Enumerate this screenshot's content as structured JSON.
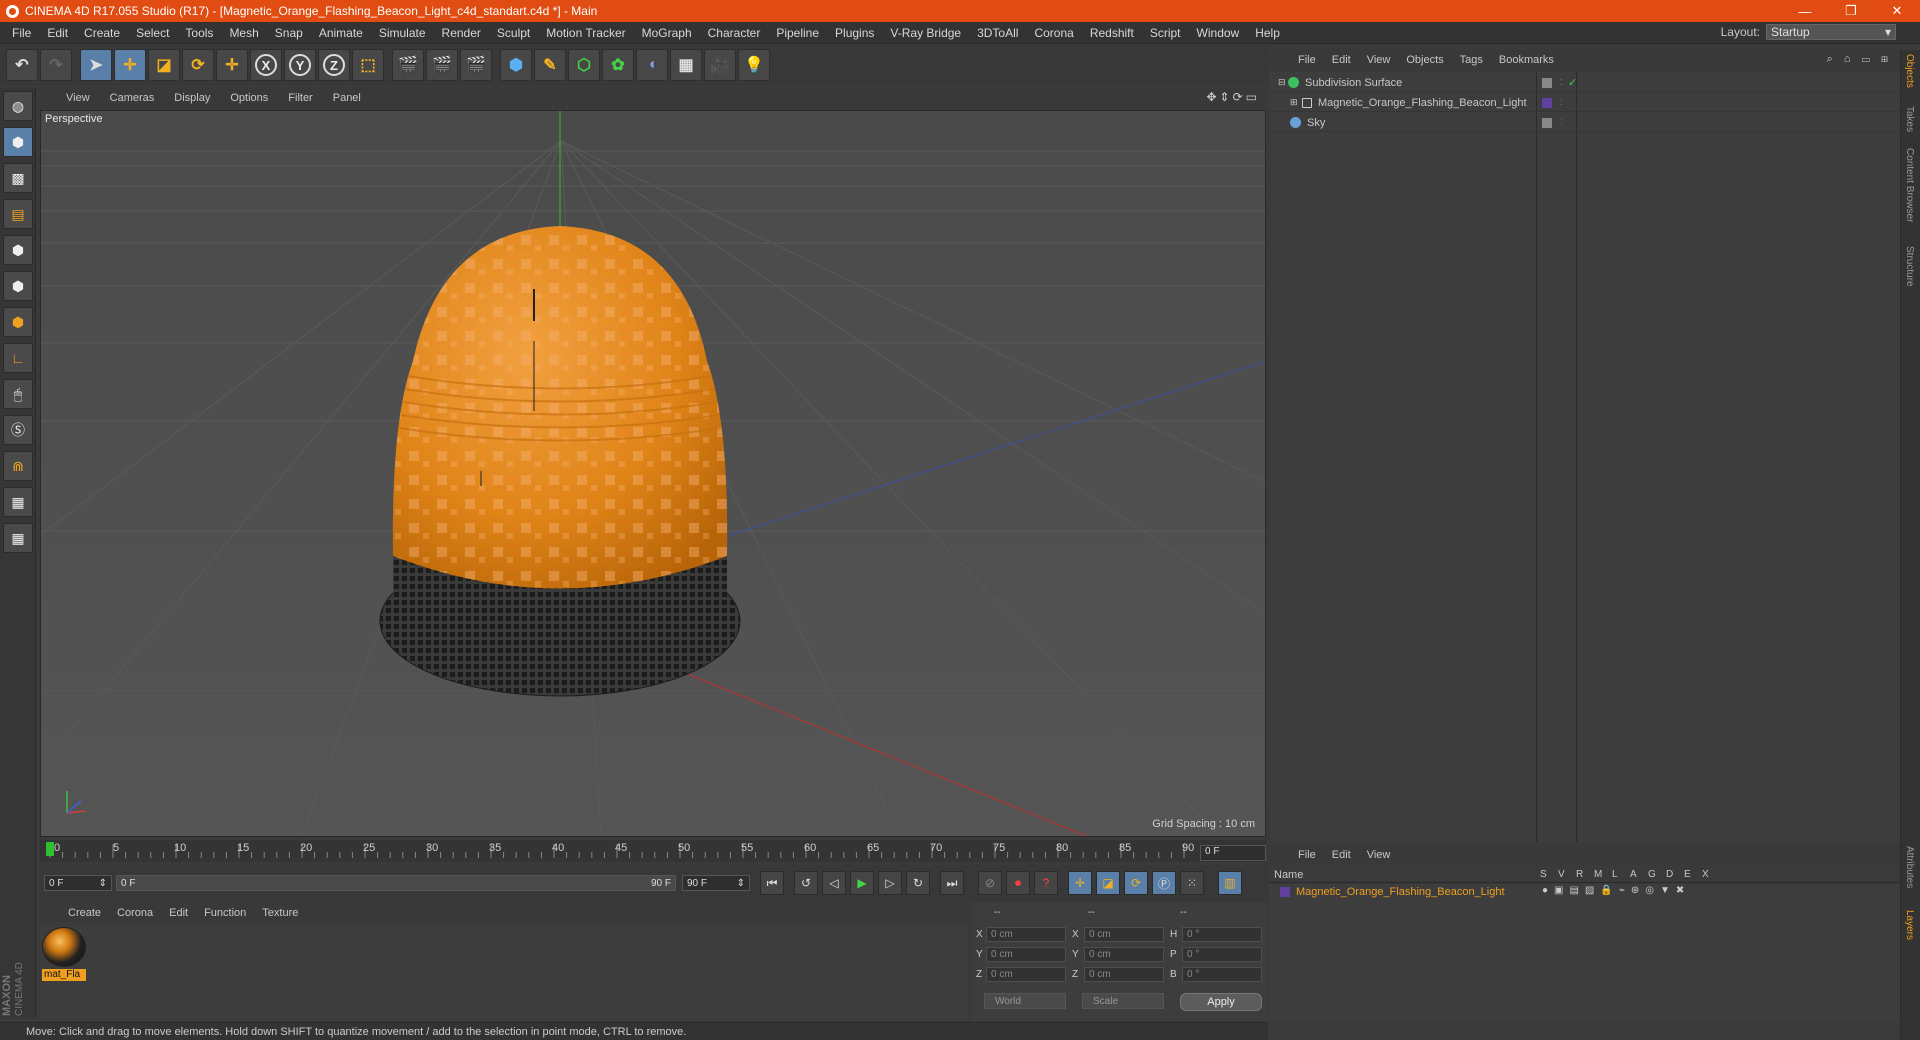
{
  "window": {
    "title": "CINEMA 4D R17.055 Studio (R17) - [Magnetic_Orange_Flashing_Beacon_Light_c4d_standart.c4d *] - Main",
    "minimize": "—",
    "restore": "❐",
    "close": "✕"
  },
  "menu": [
    "File",
    "Edit",
    "Create",
    "Select",
    "Tools",
    "Mesh",
    "Snap",
    "Animate",
    "Simulate",
    "Render",
    "Sculpt",
    "Motion Tracker",
    "MoGraph",
    "Character",
    "Pipeline",
    "Plugins",
    "V-Ray Bridge",
    "3DToAll",
    "Corona",
    "Redshift",
    "Script",
    "Window",
    "Help"
  ],
  "layout": {
    "label": "Layout:",
    "value": "Startup"
  },
  "toolbar": {
    "axis_x": "X",
    "axis_y": "Y",
    "axis_z": "Z"
  },
  "viewport": {
    "menu": [
      "View",
      "Cameras",
      "Display",
      "Options",
      "Filter",
      "Panel"
    ],
    "label": "Perspective",
    "grid_spacing": "Grid Spacing : 10 cm",
    "nav_icons": "✥⇕⟳▭"
  },
  "timeline": {
    "ticks": [
      "0",
      "5",
      "10",
      "15",
      "20",
      "25",
      "30",
      "35",
      "40",
      "45",
      "50",
      "55",
      "60",
      "65",
      "70",
      "75",
      "80",
      "85",
      "90"
    ],
    "current_frame": "0 F",
    "start_field": "0 F",
    "range_start": "0 F",
    "range_end": "90 F",
    "end_field": "90 F"
  },
  "material_manager": {
    "menu": [
      "Create",
      "Corona",
      "Edit",
      "Function",
      "Texture"
    ],
    "material_name": "mat_Fla"
  },
  "coordinates": {
    "header": [
      "--",
      "--",
      "--"
    ],
    "rows": [
      {
        "l1": "X",
        "v1": "0 cm",
        "l2": "X",
        "v2": "0 cm",
        "l3": "H",
        "v3": "0 °"
      },
      {
        "l1": "Y",
        "v1": "0 cm",
        "l2": "Y",
        "v2": "0 cm",
        "l3": "P",
        "v3": "0 °"
      },
      {
        "l1": "Z",
        "v1": "0 cm",
        "l2": "Z",
        "v2": "0 cm",
        "l3": "B",
        "v3": "0 °"
      }
    ],
    "mode1": "World",
    "mode2": "Scale",
    "apply": "Apply"
  },
  "status": "Move: Click and drag to move elements. Hold down SHIFT to quantize movement / add to the selection in point mode, CTRL to remove.",
  "object_manager": {
    "menu": [
      "File",
      "Edit",
      "View",
      "Objects",
      "Tags",
      "Bookmarks"
    ],
    "objects": [
      {
        "name": "Subdivision Surface",
        "icon_color": "#3cc060"
      },
      {
        "name": "Magnetic_Orange_Flashing_Beacon_Light",
        "icon_color": "#cccccc"
      },
      {
        "name": "Sky",
        "icon_color": "#6aa0d8"
      }
    ]
  },
  "layer_manager": {
    "menu": [
      "File",
      "Edit",
      "View"
    ],
    "name_header": "Name",
    "columns": [
      "S",
      "V",
      "R",
      "M",
      "L",
      "A",
      "G",
      "D",
      "E",
      "X"
    ],
    "layer_name": "Magnetic_Orange_Flashing_Beacon_Light"
  },
  "right_tabs": [
    "Objects",
    "Takes",
    "Content Browser",
    "Structure",
    "Attributes",
    "Layers"
  ],
  "brand": "MAXON CINEMA 4D",
  "colors": {
    "accent": "#e04c12",
    "selection": "#5a7fa8",
    "highlight": "#f0a020"
  }
}
